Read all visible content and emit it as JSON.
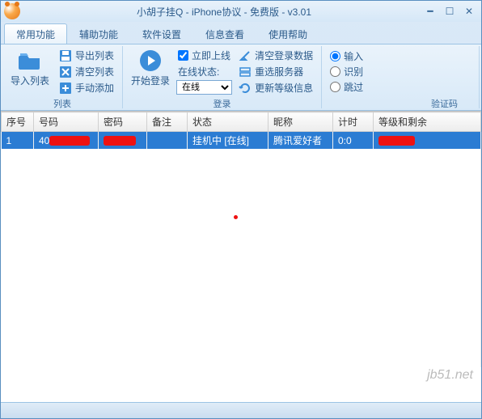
{
  "window": {
    "title": "小胡子挂Q - iPhone协议 - 免费版 - v3.01"
  },
  "menu": {
    "items": [
      "常用功能",
      "辅助功能",
      "软件设置",
      "信息查看",
      "使用帮助"
    ],
    "active": 0
  },
  "ribbon": {
    "group_list": {
      "label": "列表",
      "import": "导入列表",
      "export": "导出列表",
      "clear": "清空列表",
      "add": "手动添加"
    },
    "group_login": {
      "label": "登录",
      "start": "开始登录",
      "online_now": "立即上线",
      "clear_login": "清空登录数据",
      "status_label": "在线状态:",
      "status_value": "在线",
      "reselect": "重选服务器",
      "update": "更新等级信息"
    },
    "group_captcha": {
      "label": "验证码",
      "input": "输入",
      "recognize": "识别",
      "skip": "跳过"
    }
  },
  "table": {
    "headers": [
      "序号",
      "号码",
      "密码",
      "备注",
      "状态",
      "昵称",
      "计时",
      "等级和剩余"
    ],
    "rows": [
      {
        "seq": "1",
        "qq": "40",
        "pwd": "",
        "note": "",
        "status": "挂机中 [在线]",
        "nick": "腾讯爱好者",
        "timer": "0:0",
        "level": ""
      }
    ]
  },
  "watermark": "jb51.net"
}
